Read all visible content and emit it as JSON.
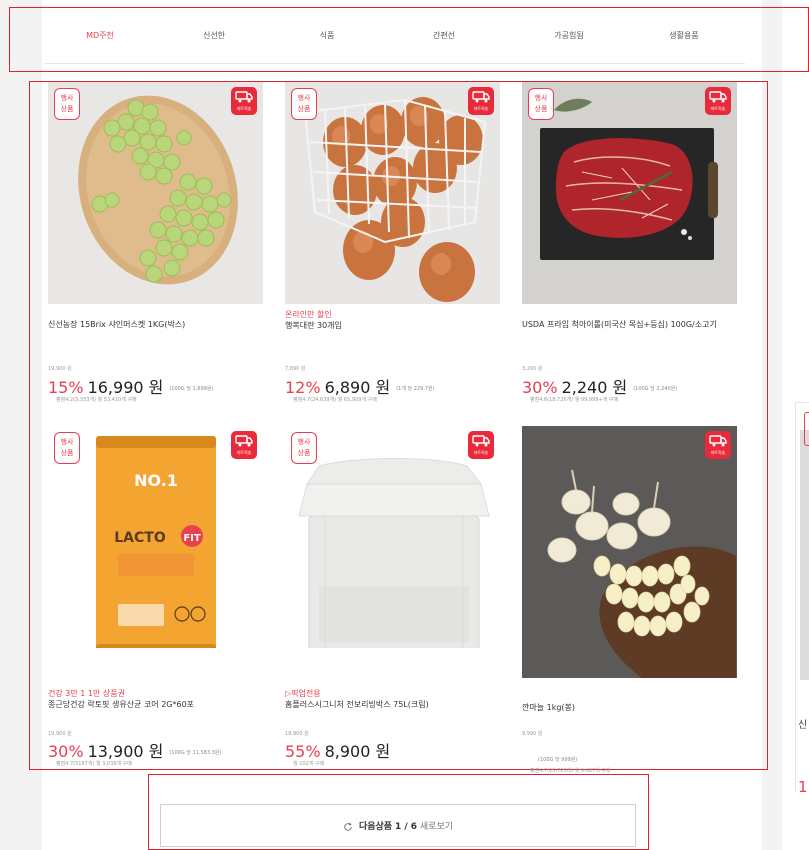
{
  "tabs": [
    {
      "label": "MD주천",
      "active": true
    },
    {
      "label": "신선한",
      "active": false
    },
    {
      "label": "식품",
      "active": false
    },
    {
      "label": "간편선",
      "active": false
    },
    {
      "label": "가공힘됨",
      "active": false
    },
    {
      "label": "생활용품",
      "active": false
    }
  ],
  "badges": {
    "event": [
      "행사",
      "상품"
    ],
    "mart_delivery": "마트직송"
  },
  "products": [
    {
      "promo": "",
      "name": "신선농장 15Brix 샤인머스켓 1KG(박스)",
      "original_price": "19,900 원",
      "discount": "15%",
      "price": "16,990 원",
      "unit_price": "(100G 당 1,699원)",
      "meta": "평점4.2(3,333개) 월 53,410개 구매"
    },
    {
      "promo": "온라인만 할인",
      "name": "행복대란 30개입",
      "original_price": "7,890 원",
      "discount": "12%",
      "price": "6,890 원",
      "unit_price": "(1개 당 229.7원)",
      "meta": "평점4.7(24,639개) 월 65,909개 구매"
    },
    {
      "promo": "",
      "name": "USDA 프라임 척아이롤(미국산 목심+등심) 100G/소고기",
      "original_price": "3,200 원",
      "discount": "30%",
      "price": "2,240 원",
      "unit_price": "(100G 당 2,240원)",
      "meta": "평점4.6(18,726개) 월 99,999+개 구매"
    },
    {
      "promo": "건강 3만 1 1만 상품권",
      "name": "종근당건강 락토핏 생유산균 코어 2G*60포",
      "original_price": "19,900 원",
      "discount": "30%",
      "price": "13,900 원",
      "unit_price": "(100G 당 11,583.3원)",
      "meta": "평점4.7(5187개) 월 3,039개 구매"
    },
    {
      "promo": "▷픽업전용",
      "name": "홈플러스시그니처 전보리빙박스 75L(크림)",
      "original_price": "19,900 원",
      "discount": "55%",
      "price": "8,900 원",
      "unit_price": "",
      "meta": "월 102개 구매"
    },
    {
      "promo": "",
      "name": "깐마늘 1kg(봉)",
      "original_price": "9,990 원",
      "discount": "",
      "price": "",
      "unit_price": "(100G 당 999원)",
      "meta": "평점4.7(15,703개) 월 9,687개 구매"
    }
  ],
  "more_button": {
    "prefix": "다음상품",
    "page": "1 / 6",
    "suffix": "새로보기"
  },
  "side_card": {
    "name_fragment": "신",
    "price_fragment": "1"
  },
  "colors": {
    "accent": "#e8404f",
    "frame": "#d7262f"
  }
}
